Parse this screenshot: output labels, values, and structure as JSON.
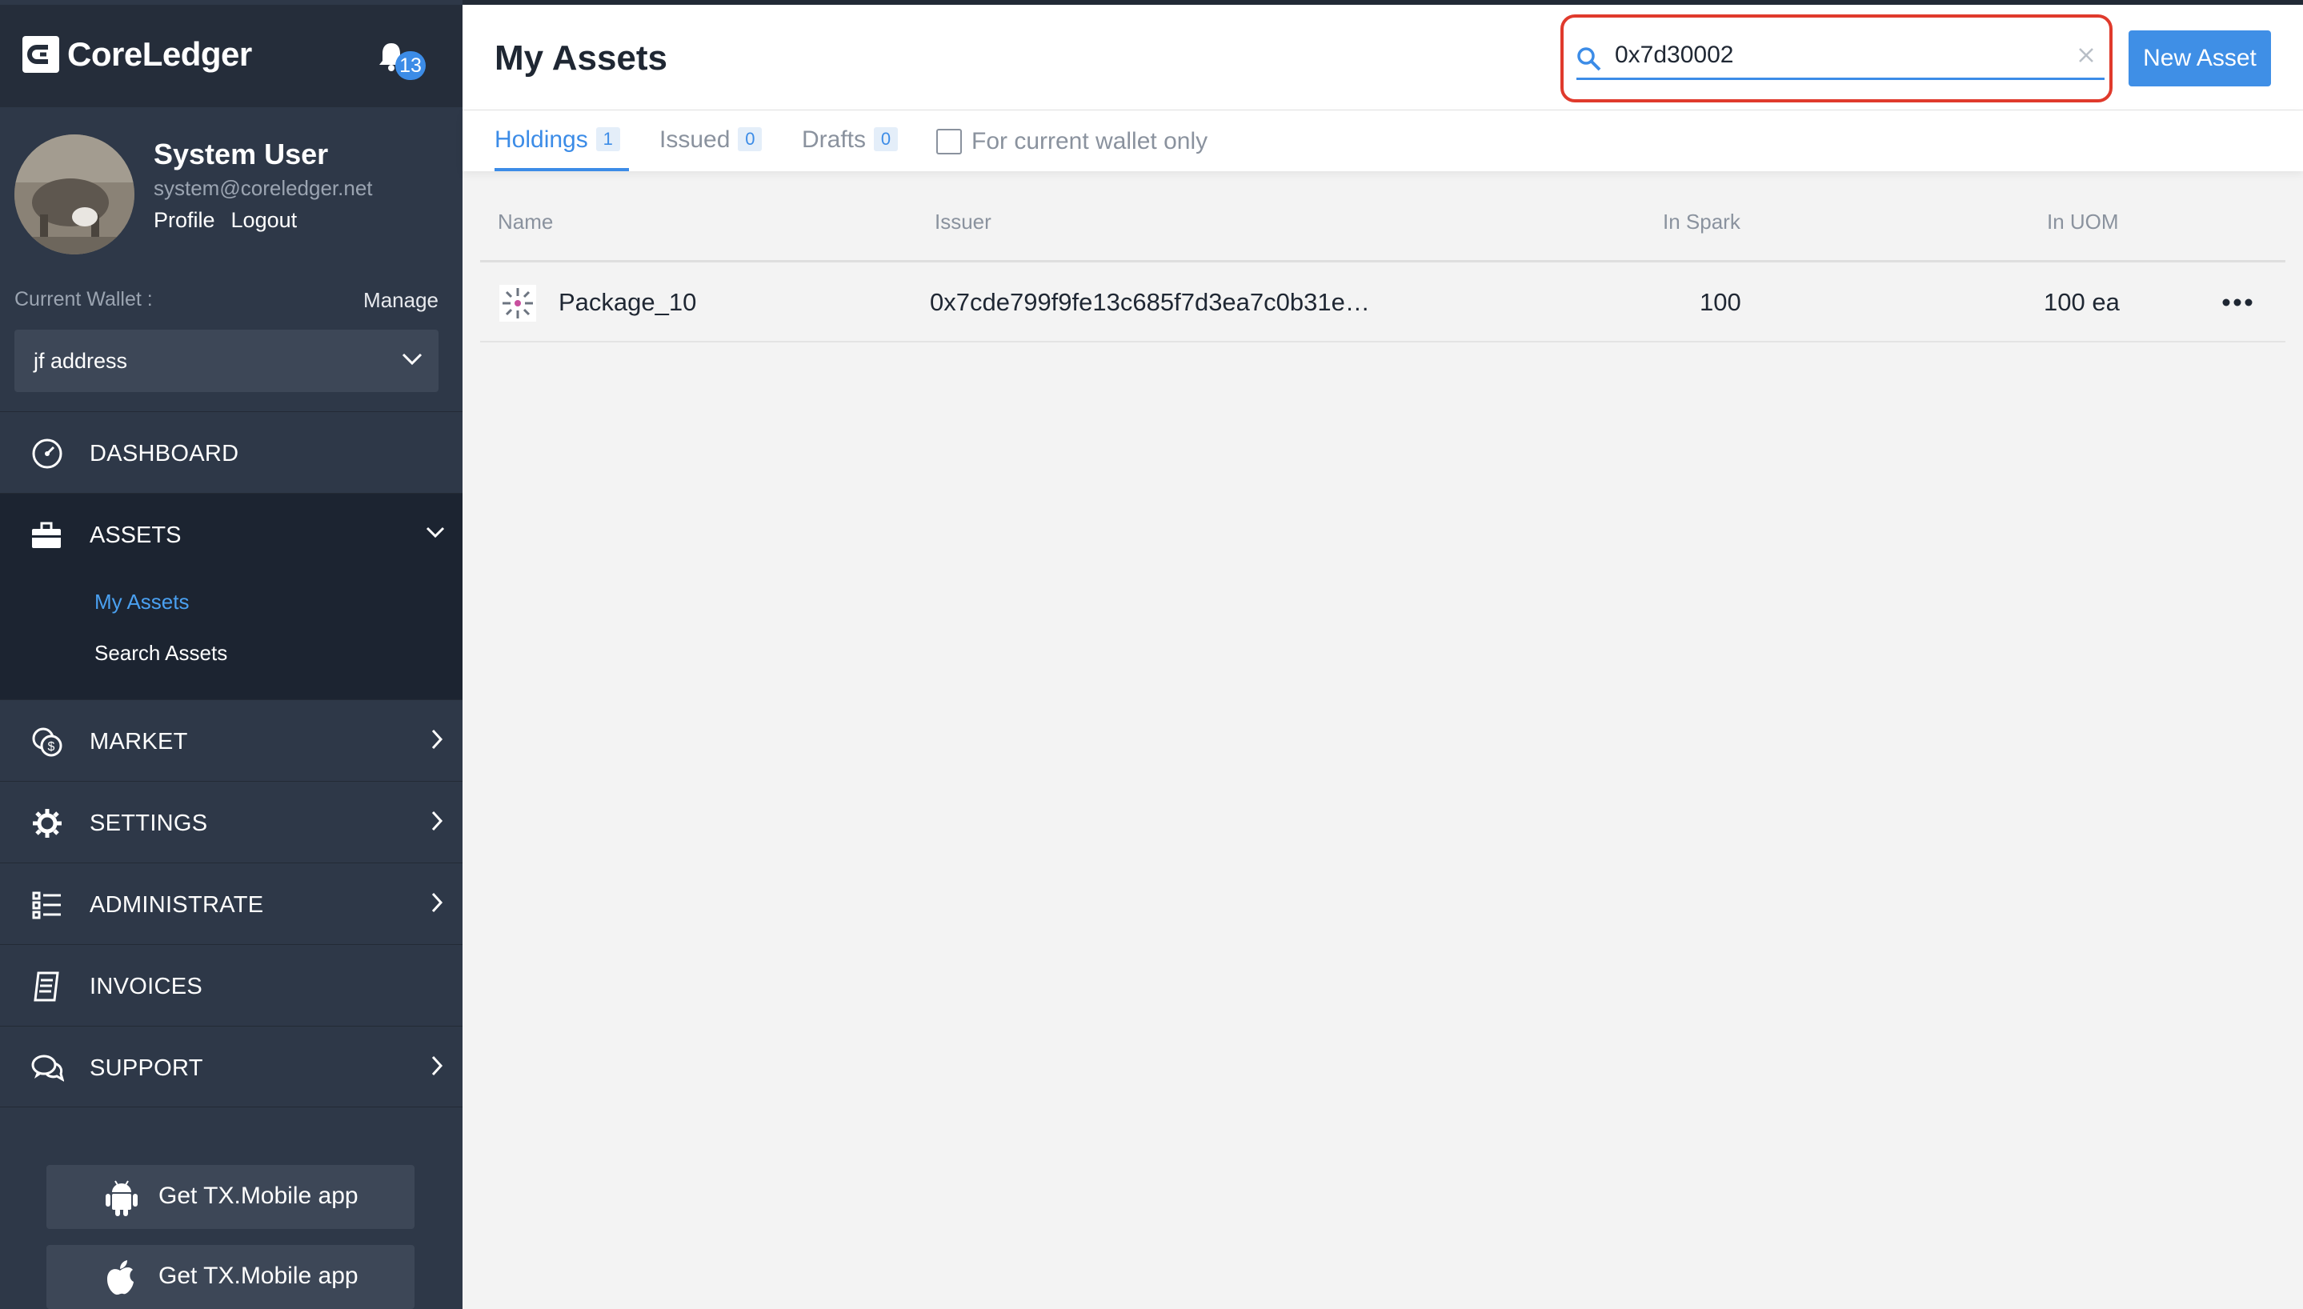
{
  "brand": {
    "name": "CoreLedger"
  },
  "notifications": {
    "count": "13"
  },
  "user": {
    "name": "System User",
    "email": "system@coreledger.net",
    "profile_label": "Profile",
    "logout_label": "Logout"
  },
  "wallet": {
    "label": "Current Wallet :",
    "manage_label": "Manage",
    "selected": "jf address"
  },
  "nav": {
    "dashboard": "DASHBOARD",
    "assets": "ASSETS",
    "assets_sub": {
      "my_assets": "My Assets",
      "search_assets": "Search Assets"
    },
    "market": "MARKET",
    "settings": "SETTINGS",
    "administrate": "ADMINISTRATE",
    "invoices": "INVOICES",
    "support": "SUPPORT"
  },
  "apps": {
    "android_label": "Get TX.Mobile app",
    "ios_label": "Get TX.Mobile app"
  },
  "page": {
    "title": "My Assets"
  },
  "search": {
    "value": "0x7d30002",
    "placeholder": ""
  },
  "actions": {
    "new_asset": "New Asset"
  },
  "tabs": [
    {
      "label": "Holdings",
      "count": "1",
      "active": true
    },
    {
      "label": "Issued",
      "count": "0",
      "active": false
    },
    {
      "label": "Drafts",
      "count": "0",
      "active": false
    }
  ],
  "filter": {
    "current_wallet_only": "For current wallet only",
    "checked": false
  },
  "table": {
    "columns": {
      "name": "Name",
      "issuer": "Issuer",
      "in_spark": "In Spark",
      "in_uom": "In UOM"
    },
    "rows": [
      {
        "name": "Package_10",
        "issuer": "0x7cde799f9fe13c685f7d3ea7c0b31e…",
        "in_spark": "100",
        "in_uom": "100 ea"
      }
    ]
  },
  "colors": {
    "accent": "#3c8ce7",
    "sidebar": "#2e3848",
    "highlight": "#e03a2c"
  }
}
